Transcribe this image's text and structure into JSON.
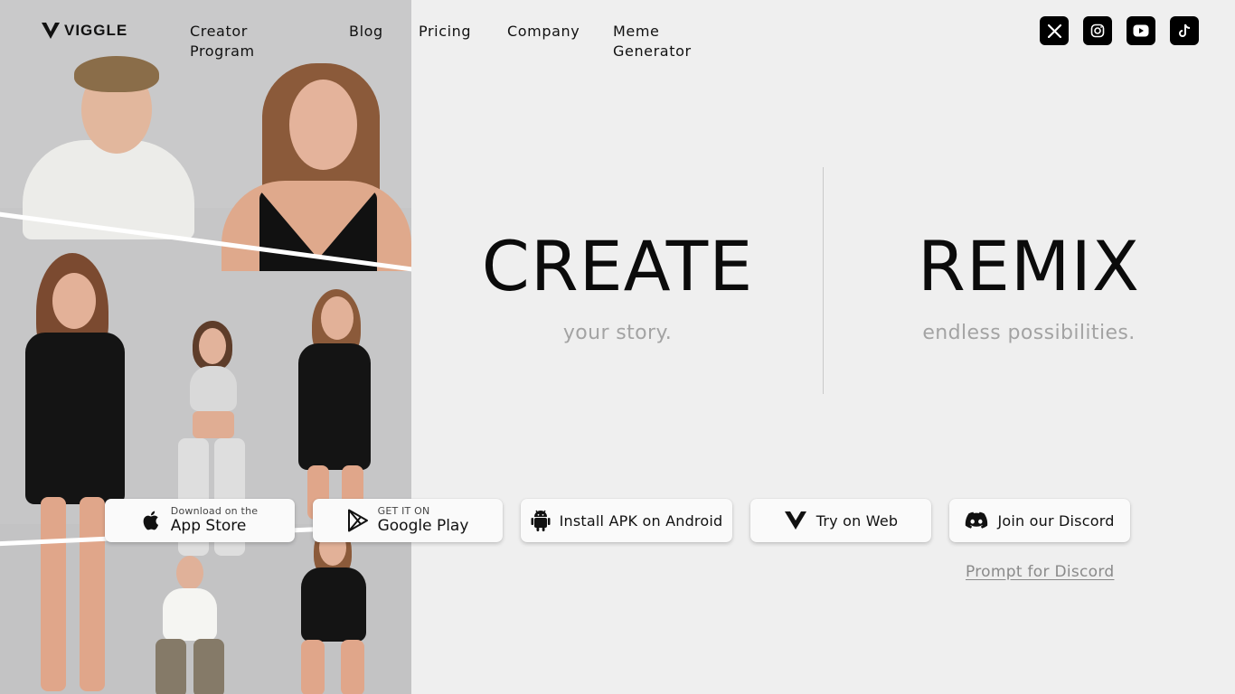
{
  "brand": {
    "name": "VIGGLE"
  },
  "nav": {
    "items": [
      {
        "label": "Creator Program"
      },
      {
        "label": "Blog"
      },
      {
        "label": "Pricing"
      },
      {
        "label": "Company"
      },
      {
        "label": "Meme Generator"
      }
    ]
  },
  "social": [
    "x-icon",
    "instagram-icon",
    "youtube-icon",
    "tiktok-icon"
  ],
  "hero": {
    "left": {
      "title": "CREATE",
      "subtitle": "your story."
    },
    "right": {
      "title": "REMIX",
      "subtitle": "endless possibilities."
    }
  },
  "downloads": {
    "app_store": {
      "small": "Download on the",
      "big": "App Store"
    },
    "google_play": {
      "small": "GET IT ON",
      "big": "Google Play"
    },
    "apk": {
      "label": "Install APK on Android"
    },
    "web": {
      "label": "Try on Web"
    },
    "discord": {
      "label": "Join our Discord"
    }
  },
  "prompt_link": "Prompt for Discord",
  "colors": {
    "background": "#efefef",
    "text": "#0b0b0b",
    "muted": "#a3a3a3",
    "collage_gray": "#c6c6c7",
    "button_bg": "#fafafa"
  }
}
